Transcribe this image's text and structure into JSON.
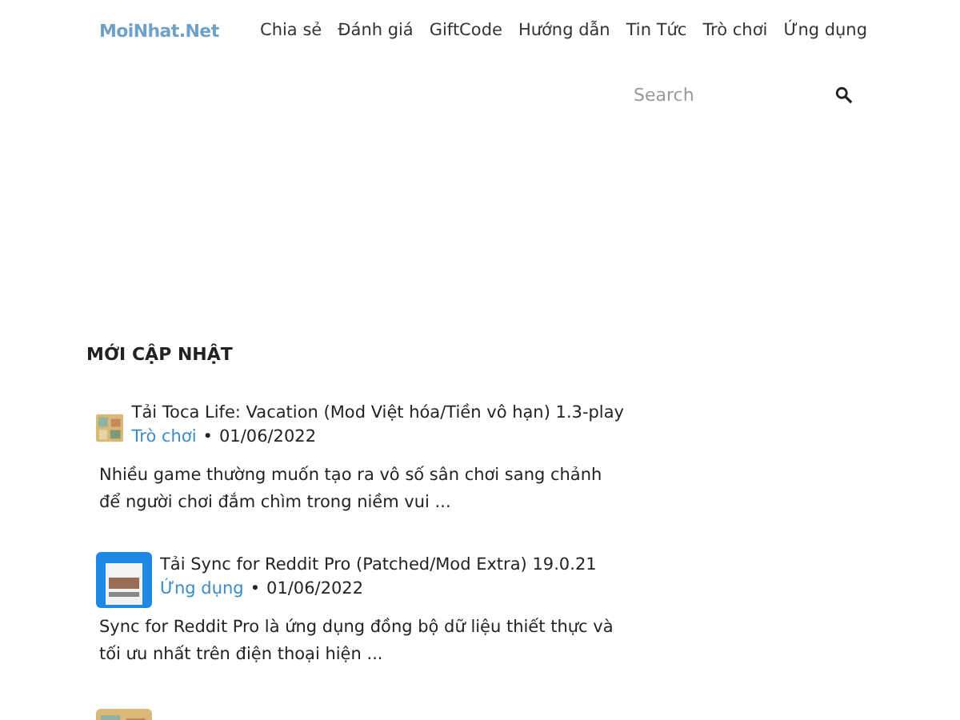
{
  "logo": "MoiNhat.Net",
  "nav": [
    "Chia sẻ",
    "Đánh giá",
    "GiftCode",
    "Hướng dẫn",
    "Tin Tức",
    "Trò chơi",
    "Ứng dụng"
  ],
  "search": {
    "placeholder": "Search"
  },
  "section_title": "MỚI CẬP NHẬT",
  "posts": [
    {
      "kind": "game",
      "title": "Tải Toca Life: Vacation (Mod Việt hóa/Tiền vô hạn) 1.3-play",
      "category": "Trò chơi",
      "separator": "•",
      "date": "01/06/2022",
      "excerpt": "Nhiều game thường muốn tạo ra vô số sân chơi sang chảnh để người chơi đắm chìm trong niềm vui ..."
    },
    {
      "kind": "app",
      "title": "Tải Sync for Reddit Pro (Patched/Mod Extra) 19.0.21",
      "category": "Ứng dụng",
      "separator": "•",
      "date": "01/06/2022",
      "excerpt": "Sync for Reddit Pro là ứng dụng đồng bộ dữ liệu thiết thực và tối ưu nhất trên điện thoại hiện ..."
    },
    {
      "kind": "partial"
    }
  ]
}
